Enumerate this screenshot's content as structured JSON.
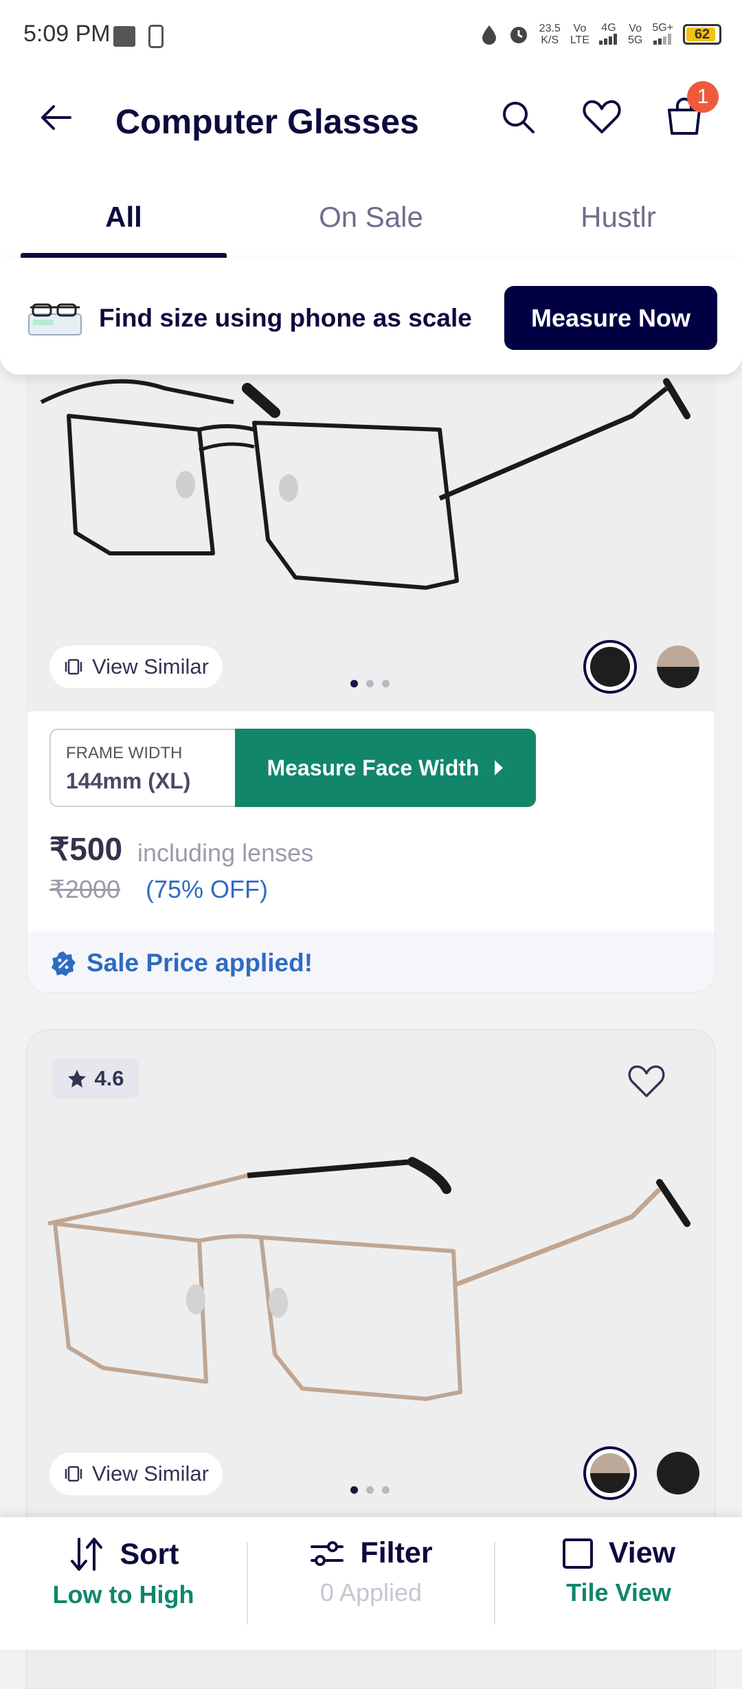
{
  "status_bar": {
    "time": "5:09 PM",
    "net_speed_value": "23.5",
    "net_speed_unit": "K/S",
    "sim1_line1": "Vo",
    "sim1_line2": "LTE",
    "net4g": "4G",
    "sim2_line1": "Vo",
    "sim2_line2": "5G",
    "net5g": "5G+",
    "battery": "62"
  },
  "header": {
    "title": "Computer Glasses",
    "cart_count": "1"
  },
  "tabs": [
    {
      "label": "All"
    },
    {
      "label": "On Sale"
    },
    {
      "label": "Hustlr"
    }
  ],
  "banner": {
    "text": "Find size using phone as scale",
    "button": "Measure Now"
  },
  "products": [
    {
      "view_similar": "View Similar",
      "swatches": [
        "#1e1e1e",
        "split-bronze-black"
      ],
      "frame_width_label": "FRAME WIDTH",
      "frame_width_value": "144mm (XL)",
      "measure_button": "Measure Face Width",
      "currency": "₹",
      "price": "500",
      "price_note": "including lenses",
      "old_price": "₹2000",
      "discount": "(75% OFF)",
      "sale_text": "Sale Price applied!"
    },
    {
      "rating": "4.6",
      "view_similar": "View Similar",
      "swatches": [
        "split-bronze-black",
        "#1e1e1e"
      ]
    }
  ],
  "bottom_bar": {
    "sort": {
      "title": "Sort",
      "sub": "Low to High"
    },
    "filter": {
      "title": "Filter",
      "sub": "0 Applied"
    },
    "view": {
      "title": "View",
      "sub": "Tile View"
    }
  },
  "colors": {
    "navy": "#0c0a3e",
    "green": "#11866a",
    "blue": "#2f6bc1",
    "badge": "#ef5a3c"
  }
}
